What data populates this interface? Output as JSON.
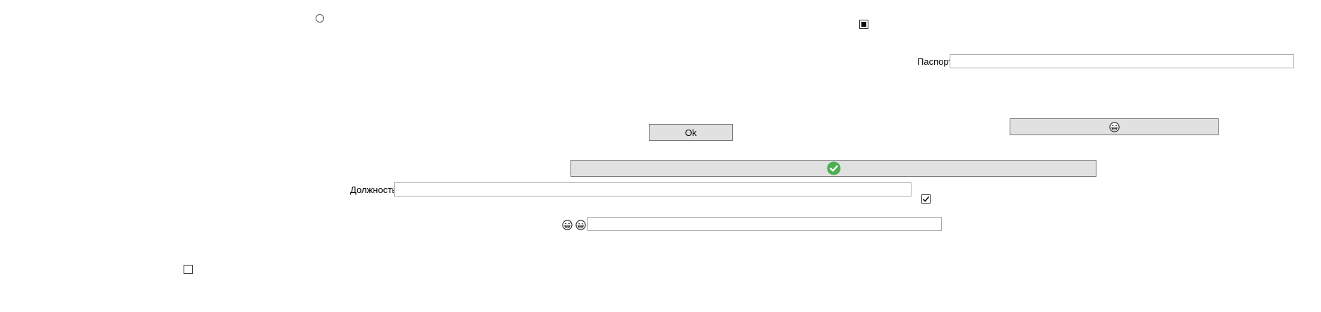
{
  "form": {
    "passport_label": "Паспорт",
    "passport_value": "",
    "position_label": "Должность",
    "position_value": "",
    "emoji_field_value": ""
  },
  "buttons": {
    "ok_label": "Ok",
    "emoji_button_icon": "grinning-face-icon",
    "confirm_button_icon": "green-check-circle-icon"
  },
  "controls": {
    "radio_checked": false,
    "indeterminate_checkbox_state": "indeterminate",
    "checked_checkbox_state": "checked",
    "bottom_checkbox_state": "unchecked"
  },
  "colors": {
    "button_face": "#e1e1e1",
    "button_border": "#777777",
    "check_green": "#4caf50"
  },
  "icons": {
    "emoji_left": "grinning-sweat-face-icon",
    "emoji_right": "grinning-face-icon"
  }
}
